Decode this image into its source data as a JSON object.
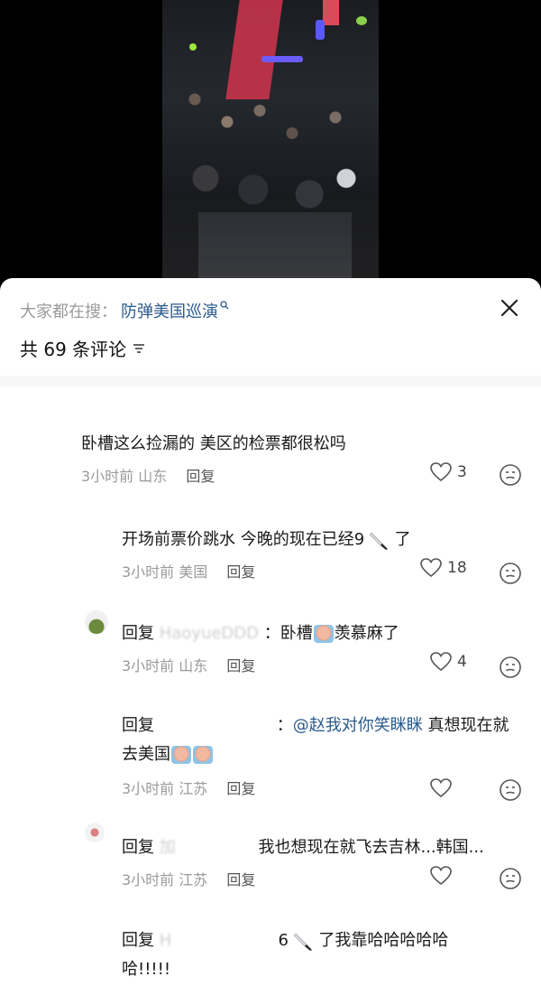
{
  "search": {
    "prefix": "大家都在搜：",
    "term": "防弹美国巡演"
  },
  "header": {
    "count_label": "共 69 条评论"
  },
  "comments": [
    {
      "text": "卧槽这么捡漏的 美区的检票都很松吗",
      "time": "3小时前",
      "location": "山东",
      "reply_label": "回复",
      "likes": "3"
    },
    {
      "text_before": "开场前票价跳水 今晚的现在已经9",
      "text_after": "了",
      "time": "3小时前",
      "location": "美国",
      "reply_label": "回复",
      "likes": "18"
    },
    {
      "prefix": "回复",
      "user": "HaoyueDDD",
      "text_before": "：卧槽",
      "text_after": "羡慕麻了",
      "time": "3小时前",
      "location": "山东",
      "reply_label": "回复",
      "likes": "4"
    },
    {
      "prefix": "回复",
      "user": "",
      "colon": "：",
      "mention": "@赵我对你笑眯眯",
      "text_line1_after": " 真想现在就",
      "text_line2": "去美国",
      "time": "3小时前",
      "location": "江苏",
      "reply_label": "回复"
    },
    {
      "prefix": "回复",
      "user": "加",
      "text": "我也想现在就飞去吉林...韩国...",
      "time": "3小时前",
      "location": "江苏",
      "reply_label": "回复"
    },
    {
      "prefix": "回复",
      "user": "H",
      "text_before": "6",
      "text_after": "了我靠哈哈哈哈哈",
      "text_line2": "哈!!!!!"
    }
  ]
}
